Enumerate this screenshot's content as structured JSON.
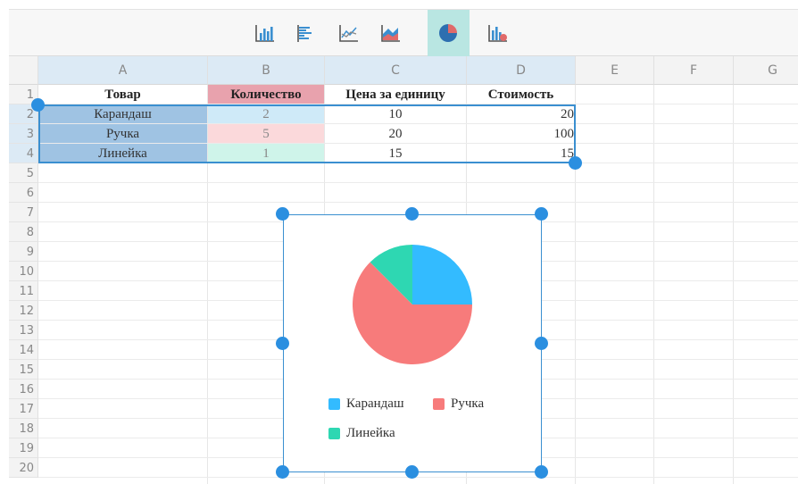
{
  "toolbar": {
    "buttons": [
      {
        "name": "bar-chart-icon"
      },
      {
        "name": "horizontal-bar-chart-icon"
      },
      {
        "name": "line-chart-icon"
      },
      {
        "name": "area-chart-icon"
      },
      {
        "name": "pie-chart-icon",
        "active": true
      },
      {
        "name": "bar-chart-delete-icon"
      }
    ]
  },
  "columns": [
    "A",
    "B",
    "C",
    "D",
    "E",
    "F",
    "G"
  ],
  "rows": [
    "1",
    "2",
    "3",
    "4",
    "5",
    "6",
    "7",
    "8",
    "9",
    "10",
    "11",
    "12",
    "13",
    "14",
    "15",
    "16",
    "17",
    "18",
    "19",
    "20"
  ],
  "table": {
    "headers": [
      "Товар",
      "Количество",
      "Цена за единицу",
      "Стоимость"
    ],
    "rows": [
      [
        "Карандаш",
        "2",
        "10",
        "20"
      ],
      [
        "Ручка",
        "5",
        "20",
        "100"
      ],
      [
        "Линейка",
        "1",
        "15",
        "15"
      ]
    ]
  },
  "colors": {
    "selection": "#3a8fd0",
    "handle": "#2b8fe0",
    "name_col_fill": "#9fc3e3",
    "qty_header_fill": "#e8a2ad",
    "qty_fills": [
      "#cfeaf8",
      "#fbd9db",
      "#cff4ea"
    ],
    "accent_tab": "#b9e6e2"
  },
  "chart_data": {
    "type": "pie",
    "labels": [
      "Карандаш",
      "Ручка",
      "Линейка"
    ],
    "values": [
      2,
      5,
      1
    ],
    "colors": [
      "#33bbff",
      "#f77b7b",
      "#2ed7b2"
    ],
    "legend": "bottom"
  }
}
